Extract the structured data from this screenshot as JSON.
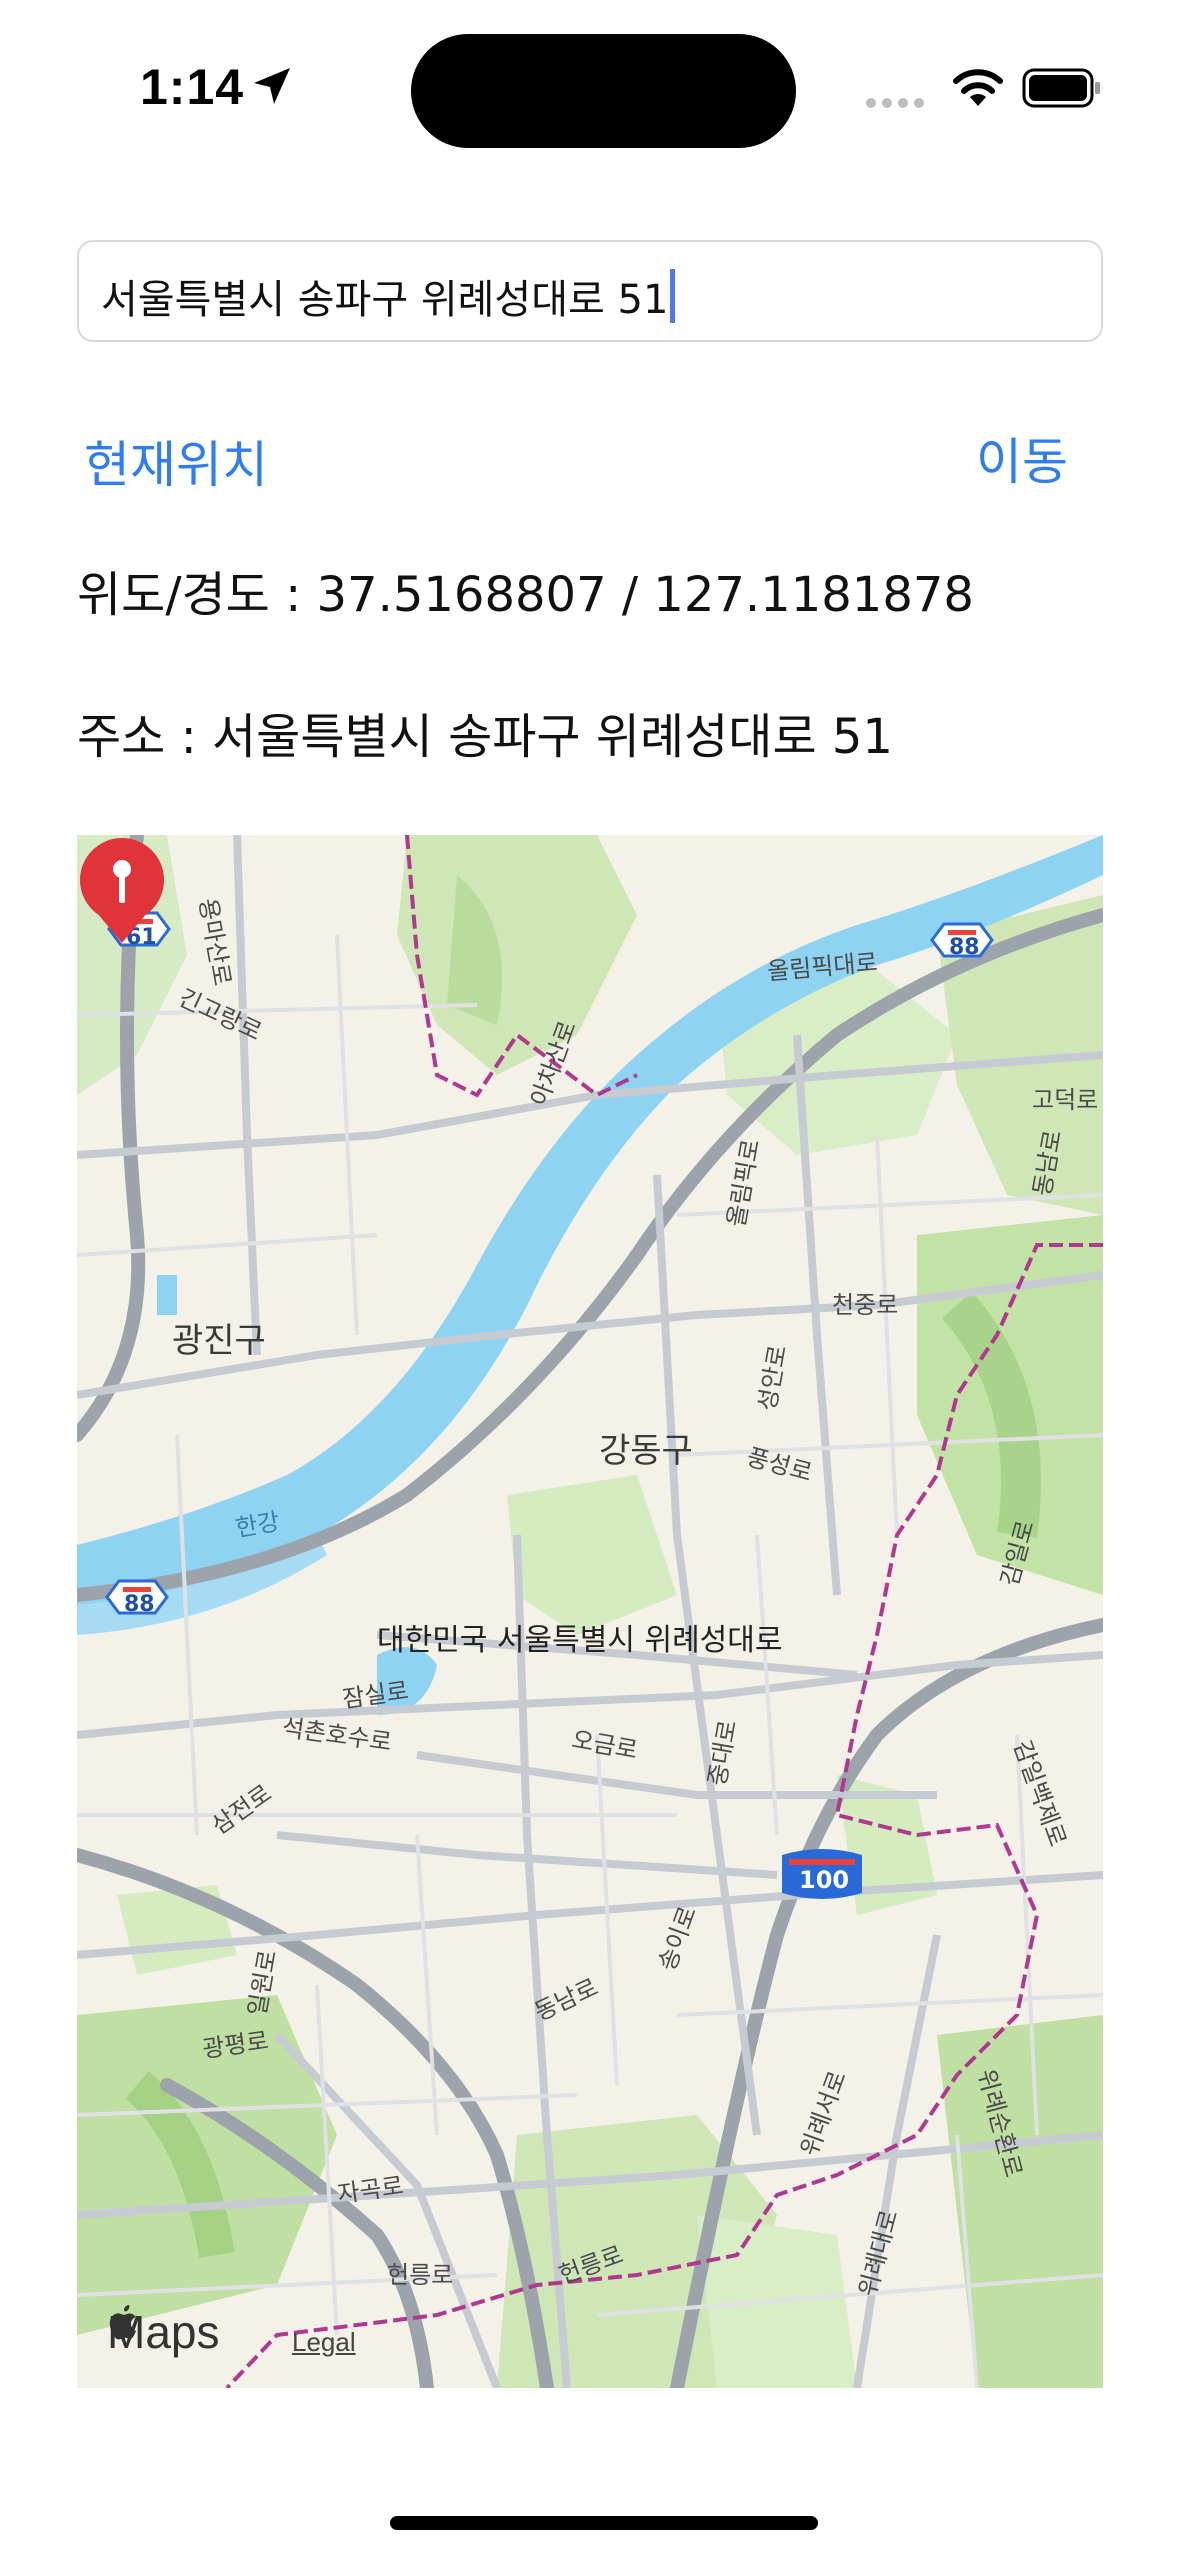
{
  "status_bar": {
    "time": "1:14"
  },
  "search": {
    "value": "서울특별시 송파구 위례성대로 51"
  },
  "buttons": {
    "current_location": "현재위치",
    "move": "이동"
  },
  "info": {
    "coordinates": "위도/경도 : 37.5168807 / 127.1181878",
    "address": "주소 : 서울특별시 송파구 위례성대로 51"
  },
  "map": {
    "districts": {
      "gwangjin": "광진구",
      "gangdong": "강동구",
      "han_river": "한강"
    },
    "shields": {
      "s61": "61",
      "s88_top": "88",
      "s88_left": "88",
      "s100": "100"
    },
    "roads": {
      "yongmasan": "용마산로",
      "gingorang": "긴고랑로",
      "achasan": "아차산로",
      "olympic_upper": "올림픽대로",
      "godeok": "고덕로",
      "dongnam_upper": "동남로",
      "olympic_vertical": "올림픽로",
      "cheonjung": "천중로",
      "seongan": "성안로",
      "pungseong": "풍성로",
      "gamil": "감일로",
      "jamsil": "잠실로",
      "seokchon": "석촌호수로",
      "ogeum": "오금로",
      "jungdae": "중대로",
      "samjeon": "삼전로",
      "gamilbaekje": "감일백제로",
      "songi": "송이로",
      "dongnam_lower": "동남로",
      "gwangpyeong": "광평로",
      "jagok": "자곡로",
      "heolleung_a": "헌릉로",
      "heolleung_b": "헌릉로",
      "wirye_seo": "위례서로",
      "wirye_dae": "위례대로",
      "wirye_sunhwan": "위례순환로",
      "ilwon": "일원로"
    },
    "pin_label": "대한민국 서울특별시 위례성대로",
    "maps_brand": "Maps",
    "legal": "Legal"
  }
}
